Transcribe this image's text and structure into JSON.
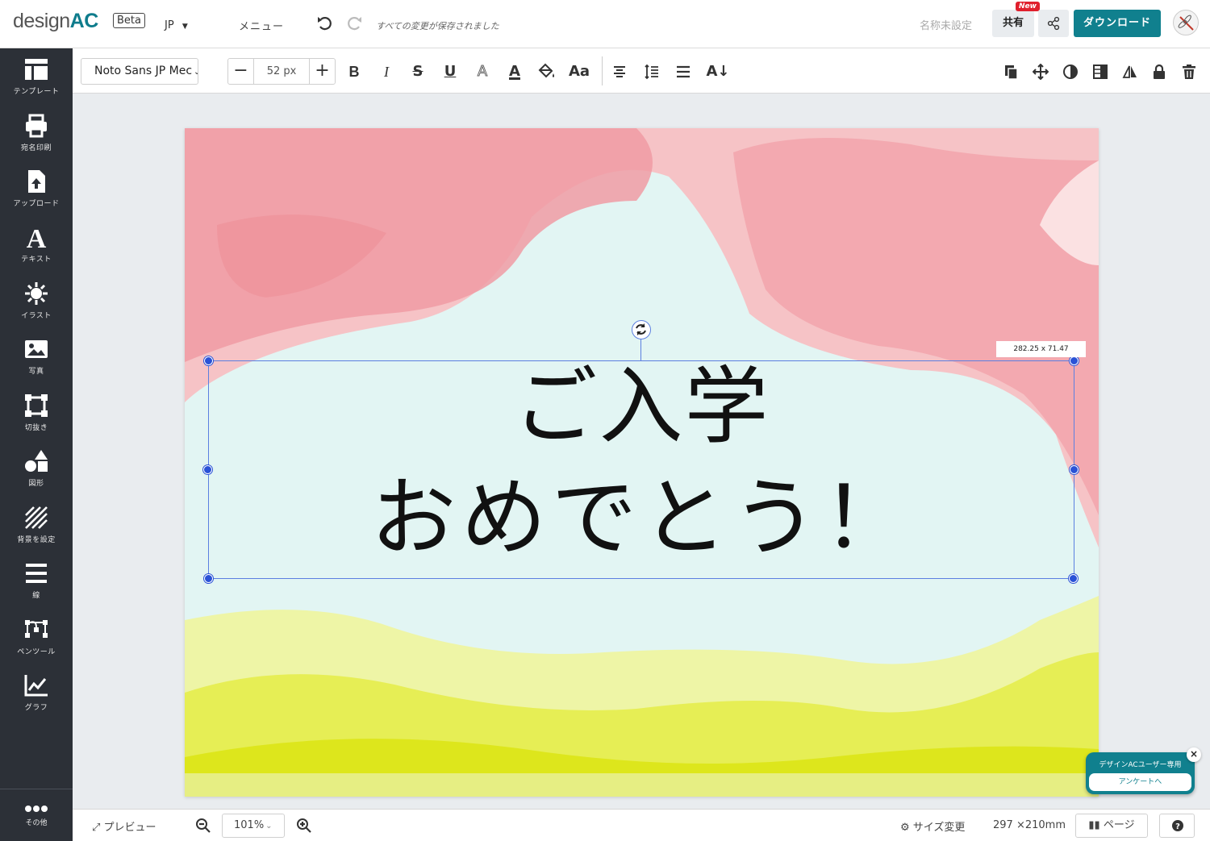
{
  "header": {
    "logo_prefix": "design",
    "logo_suffix": "AC",
    "beta": "Beta",
    "lang": "JP",
    "menu": "メニュー",
    "save_status": "すべての変更が保存されました",
    "title_placeholder": "名称未設定",
    "share": "共有",
    "new_badge": "New",
    "download": "ダウンロード"
  },
  "sidebar": {
    "items": [
      {
        "label": "テンプレート",
        "icon": "template-icon"
      },
      {
        "label": "宛名印刷",
        "icon": "printer-icon"
      },
      {
        "label": "アップロード",
        "icon": "upload-icon"
      },
      {
        "label": "テキスト",
        "icon": "text-icon"
      },
      {
        "label": "イラスト",
        "icon": "illustration-icon"
      },
      {
        "label": "写真",
        "icon": "photo-icon"
      },
      {
        "label": "切抜き",
        "icon": "crop-icon"
      },
      {
        "label": "図形",
        "icon": "shapes-icon"
      },
      {
        "label": "背景を設定",
        "icon": "background-icon"
      },
      {
        "label": "線",
        "icon": "lines-icon"
      },
      {
        "label": "ペンツール",
        "icon": "pen-tool-icon"
      },
      {
        "label": "グラフ",
        "icon": "graph-icon"
      }
    ],
    "more": "その他"
  },
  "toolbar": {
    "font": "Noto Sans JP Mec",
    "font_size": "52 px",
    "bold": "B",
    "italic": "I",
    "strike": "S",
    "underline": "U",
    "outline": "A",
    "font_color": "A",
    "case": "Aa",
    "sort": "A↓"
  },
  "canvas": {
    "line1": "ご入学",
    "line2": "おめでとう！",
    "dims": "282.25 x 71.47",
    "colors": {
      "pink": "#f29aa2",
      "mint": "#d9f1ef",
      "lime": "#dfe620"
    }
  },
  "survey": {
    "title": "デザインACユーザー専用",
    "link": "アンケートへ",
    "close": "×"
  },
  "bottom": {
    "preview": "プレビュー",
    "zoom": "101%",
    "resize": "サイズ変更",
    "paper": "297 ×210mm",
    "pages": "ページ"
  }
}
